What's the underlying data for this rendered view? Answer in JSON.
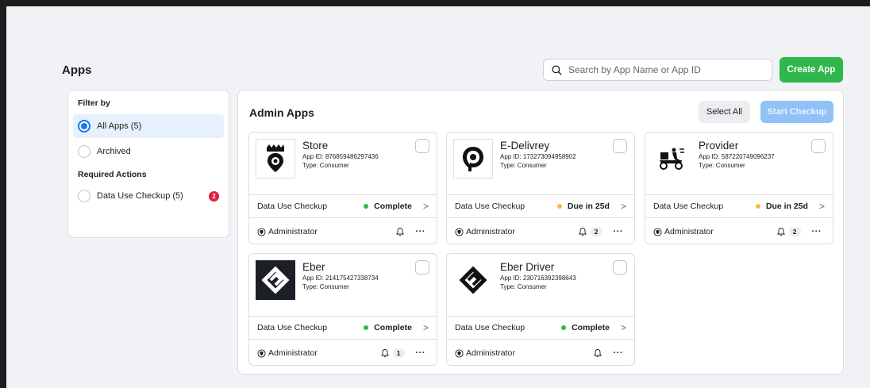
{
  "page": {
    "title": "Apps"
  },
  "search": {
    "placeholder": "Search by App Name or App ID"
  },
  "header": {
    "create_label": "Create App"
  },
  "filter": {
    "heading": "Filter by",
    "items": [
      {
        "label": "All Apps (5)",
        "selected": true
      },
      {
        "label": "Archived",
        "selected": false
      }
    ],
    "required_heading": "Required Actions",
    "required_items": [
      {
        "label": "Data Use Checkup (5)",
        "badge": "2"
      }
    ]
  },
  "main": {
    "title": "Admin Apps",
    "select_all_label": "Select All",
    "start_checkup_label": "Start Checkup"
  },
  "colors": {
    "accent": "#1877f2",
    "create": "#2fb74b",
    "complete": "#2fb74b",
    "due": "#f5b942",
    "badge": "#e41e3f"
  },
  "cards": [
    {
      "name": "Store",
      "app_id": "App ID: 876859486297436",
      "type": "Type: Consumer",
      "row_label": "Data Use Checkup",
      "status": "Complete",
      "status_color": "#2fb74b",
      "role": "Administrator",
      "notifications": "",
      "logo": "store-logo"
    },
    {
      "name": "E-Delivrey",
      "app_id": "App ID: 173273094958902",
      "type": "Type: Consumer",
      "row_label": "Data Use Checkup",
      "status": "Due in 25d",
      "status_color": "#f5b942",
      "role": "Administrator",
      "notifications": "2",
      "logo": "edelivery-logo"
    },
    {
      "name": "Provider",
      "app_id": "App ID: 587220749096237",
      "type": "Type: Consumer",
      "row_label": "Data Use Checkup",
      "status": "Due in 25d",
      "status_color": "#f5b942",
      "role": "Administrator",
      "notifications": "2",
      "logo": "provider-logo"
    },
    {
      "name": "Eber",
      "app_id": "App ID: 214175427338734",
      "type": "Type: Consumer",
      "row_label": "Data Use Checkup",
      "status": "Complete",
      "status_color": "#2fb74b",
      "role": "Administrator",
      "notifications": "1",
      "logo": "eber-logo"
    },
    {
      "name": "Eber Driver",
      "app_id": "App ID: 230716392398643",
      "type": "Type: Consumer",
      "row_label": "Data Use Checkup",
      "status": "Complete",
      "status_color": "#2fb74b",
      "role": "Administrator",
      "notifications": "",
      "logo": "eber-driver-logo"
    }
  ]
}
